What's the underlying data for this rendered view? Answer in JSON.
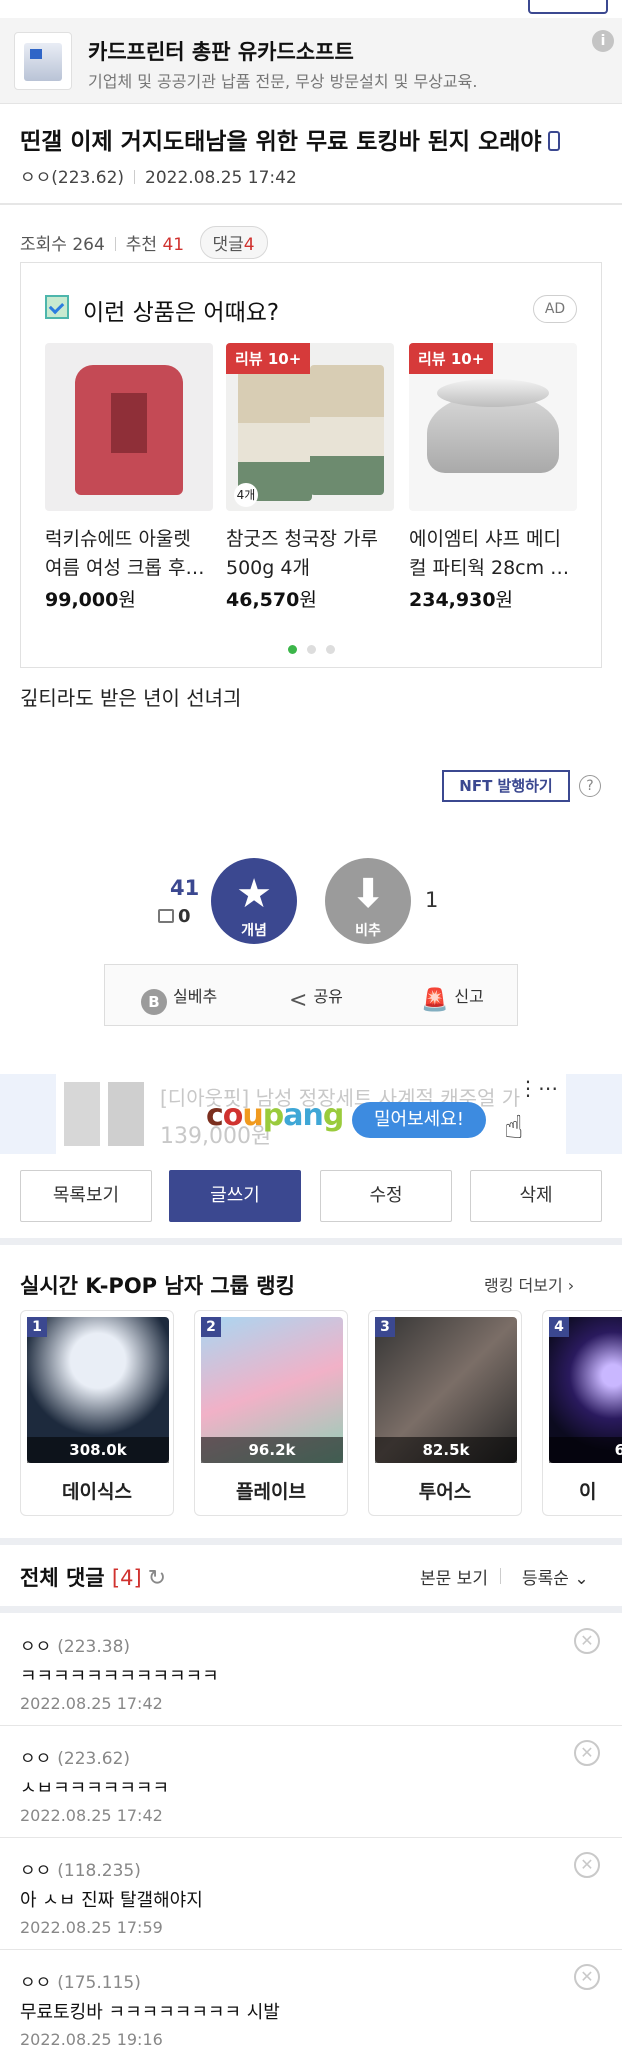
{
  "top_ad": {
    "name": "카드프린터 총판 유카드소프트",
    "desc": "기업체 및 공공기관 납품 전문, 무상 방문설치 및 무상교육.",
    "info_icon": "i"
  },
  "post": {
    "title": "띤갤 이제 거지도태남을 위한 무료 토킹바 된지 오래야",
    "author": "ㅇㅇ(223.62)",
    "datetime": "2022.08.25 17:42",
    "views_label": "조회수",
    "views": "264",
    "recommend_label": "추천",
    "recommend": "41",
    "comments_label": "댓글",
    "comments": "4",
    "body": "깊티라도 받은 년이 선녀긔"
  },
  "product_box": {
    "heading": "이런 상품은 어때요?",
    "ad_label": "AD",
    "products": [
      {
        "name": "럭키슈에뜨 아울렛 여름 여성 크롭 후…",
        "price": "99,000",
        "won": "원",
        "badge": ""
      },
      {
        "name": "참굿즈 청국장 가루 500g 4개",
        "price": "46,570",
        "won": "원",
        "badge": "리뷰 10+"
      },
      {
        "name": "에이엠티 샤프 메디컬 파티웍 28cm …",
        "price": "234,930",
        "won": "원",
        "badge": "리뷰 10+"
      }
    ],
    "bag_label": "4개"
  },
  "nft": {
    "label": "NFT 발행하기",
    "help": "?"
  },
  "vote": {
    "up_count": "41",
    "up_sub": "0",
    "up_label": "개념",
    "down_label": "비추",
    "down_count": "1"
  },
  "actions": {
    "silbe": "실베추",
    "share": "공유",
    "report": "신고",
    "b_icon": "B"
  },
  "coupang_ad": {
    "faded_text": "[디아웃핏] 남성 정장세트 사계절 캐주얼 가",
    "faded_price": "139,000원",
    "logo": "coupang",
    "cta": "밀어보세요!",
    "more": "⋮⋯"
  },
  "buttons": {
    "list": "목록보기",
    "write": "글쓰기",
    "edit": "수정",
    "delete": "삭제"
  },
  "ranking": {
    "title": "실시간 K-POP 남자 그룹 랭킹",
    "more": "랭킹 더보기",
    "items": [
      {
        "rank": "1",
        "votes": "308.0k",
        "name": "데이식스"
      },
      {
        "rank": "2",
        "votes": "96.2k",
        "name": "플레이브"
      },
      {
        "rank": "3",
        "votes": "82.5k",
        "name": "투어스"
      },
      {
        "rank": "4",
        "votes": "6",
        "name": "이"
      }
    ]
  },
  "comments_section": {
    "title": "전체 댓글",
    "count": "[4]",
    "view_body": "본문 보기",
    "sort": "등록순",
    "items": [
      {
        "nick": "ㅇㅇ",
        "ip": "(223.38)",
        "text": "ㅋㅋㅋㅋㅋㅋㅋㅋㅋㅋㅋㅋ",
        "date": "2022.08.25 17:42"
      },
      {
        "nick": "ㅇㅇ",
        "ip": "(223.62)",
        "text": "ㅅㅂㅋㅋㅋㅋㅋㅋㅋ",
        "date": "2022.08.25 17:42"
      },
      {
        "nick": "ㅇㅇ",
        "ip": "(118.235)",
        "text": "아 ㅅㅂ 진짜 탈갤해야지",
        "date": "2022.08.25 17:59"
      },
      {
        "nick": "ㅇㅇ",
        "ip": "(175.115)",
        "text": "무료토킹바 ㅋㅋㅋㅋㅋㅋㅋㅋ 시발",
        "date": "2022.08.25 19:16"
      }
    ]
  },
  "colors": {
    "accent": "#3b4890",
    "red": "#d0322f",
    "green": "#3cb64a",
    "coupang_blue": "#3d8be0"
  }
}
